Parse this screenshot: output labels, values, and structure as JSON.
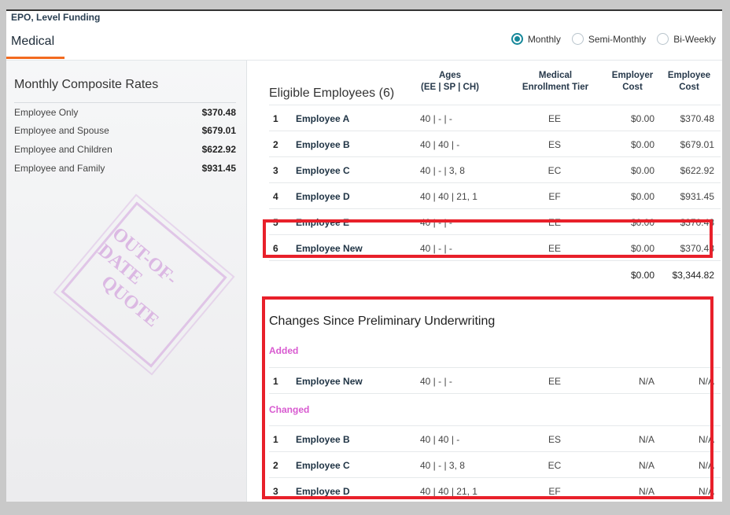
{
  "plan": {
    "title": "EPO, Level Funding"
  },
  "tab": {
    "title": "Medical"
  },
  "frequency": {
    "options": [
      {
        "label": "Monthly",
        "selected": true
      },
      {
        "label": "Semi-Monthly",
        "selected": false
      },
      {
        "label": "Bi-Weekly",
        "selected": false
      }
    ]
  },
  "rates": {
    "title": "Monthly Composite Rates",
    "rows": [
      {
        "label": "Employee Only",
        "value": "$370.48"
      },
      {
        "label": "Employee and Spouse",
        "value": "$679.01"
      },
      {
        "label": "Employee and Children",
        "value": "$622.92"
      },
      {
        "label": "Employee and Family",
        "value": "$931.45"
      }
    ],
    "stamp": [
      "OUT-OF-DATE",
      "QUOTE"
    ]
  },
  "employees": {
    "title": "Eligible Employees (6)",
    "columns": {
      "ages": "Ages",
      "ages_sub": "(EE | SP | CH)",
      "tier": "Medical",
      "tier_sub": "Enrollment Tier",
      "er": "Employer",
      "er_sub": "Cost",
      "ee": "Employee",
      "ee_sub": "Cost"
    },
    "rows": [
      {
        "num": "1",
        "name": "Employee A",
        "ages": "40 |  -  |  -",
        "tier": "EE",
        "er": "$0.00",
        "ee": "$370.48"
      },
      {
        "num": "2",
        "name": "Employee B",
        "ages": "40 | 40 |  -",
        "tier": "ES",
        "er": "$0.00",
        "ee": "$679.01"
      },
      {
        "num": "3",
        "name": "Employee C",
        "ages": "40 |  -  | 3, 8",
        "tier": "EC",
        "er": "$0.00",
        "ee": "$622.92"
      },
      {
        "num": "4",
        "name": "Employee D",
        "ages": "40 | 40 | 21, 1",
        "tier": "EF",
        "er": "$0.00",
        "ee": "$931.45"
      },
      {
        "num": "5",
        "name": "Employee E",
        "ages": "40 |  -  |  -",
        "tier": "EE",
        "er": "$0.00",
        "ee": "$370.48"
      },
      {
        "num": "6",
        "name": "Employee New",
        "ages": "40 |  -  |  -",
        "tier": "EE",
        "er": "$0.00",
        "ee": "$370.48"
      }
    ],
    "totals": {
      "er": "$0.00",
      "ee": "$3,344.82"
    }
  },
  "changes": {
    "title": "Changes Since Preliminary Underwriting",
    "added_label": "Added",
    "added": [
      {
        "num": "1",
        "name": "Employee New",
        "ages": "40 |  -  |  -",
        "tier": "EE",
        "er": "N/A",
        "ee": "N/A"
      }
    ],
    "changed_label": "Changed",
    "changed": [
      {
        "num": "1",
        "name": "Employee B",
        "ages": "40 | 40 |  -",
        "tier": "ES",
        "er": "N/A",
        "ee": "N/A"
      },
      {
        "num": "2",
        "name": "Employee C",
        "ages": "40 |  -  | 3, 8",
        "tier": "EC",
        "er": "N/A",
        "ee": "N/A"
      },
      {
        "num": "3",
        "name": "Employee D",
        "ages": "40 | 40 | 21, 1",
        "tier": "EF",
        "er": "N/A",
        "ee": "N/A"
      }
    ]
  },
  "colors": {
    "accent": "#f26a1f",
    "radio": "#16889a",
    "highlight": "#e8202a",
    "section_label": "#d85ad0"
  }
}
